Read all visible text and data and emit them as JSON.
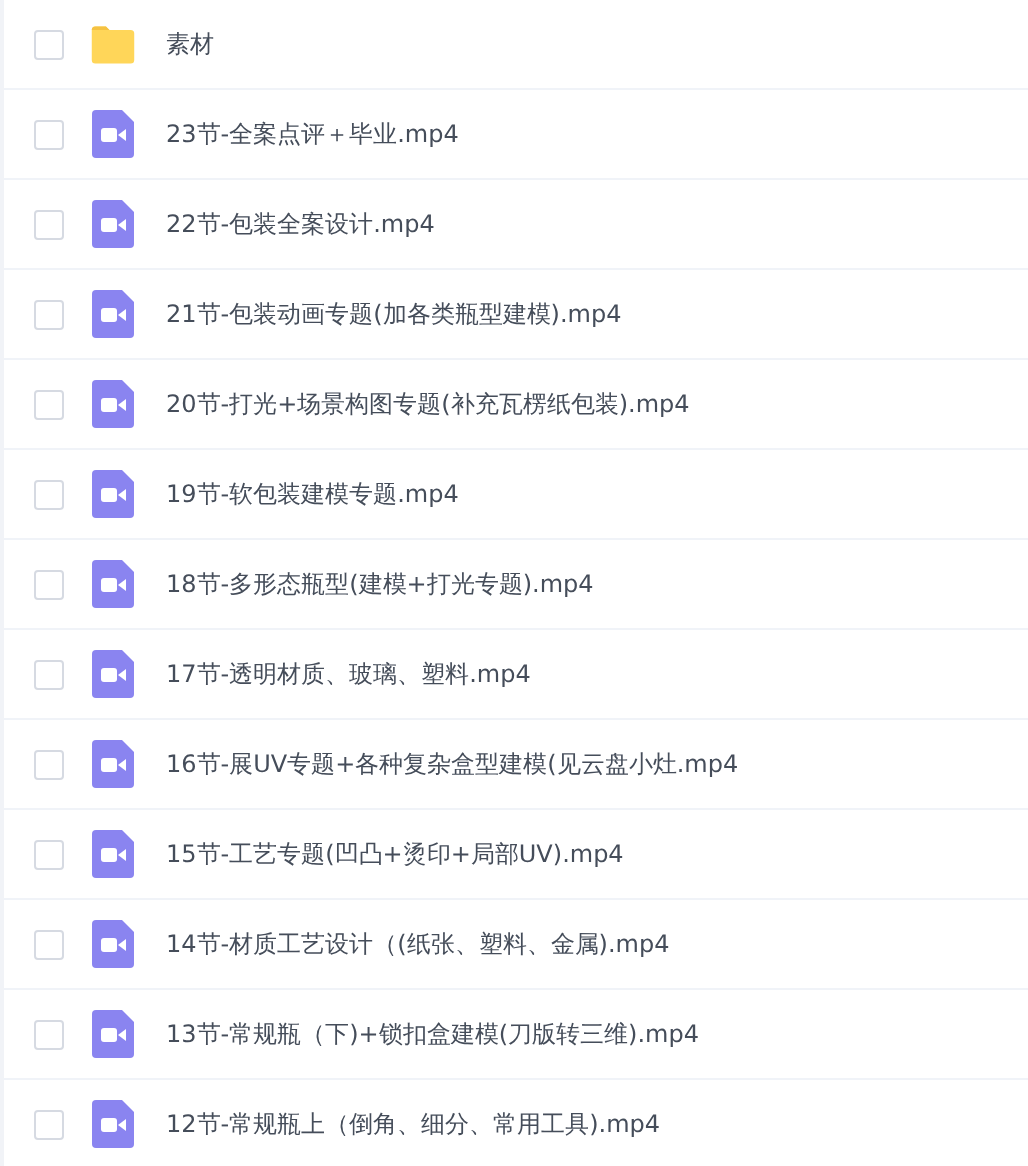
{
  "files": [
    {
      "kind": "folder",
      "name": "素材",
      "checked": false
    },
    {
      "kind": "video",
      "name": "23节-全案点评＋毕业.mp4",
      "checked": false
    },
    {
      "kind": "video",
      "name": "22节-包装全案设计.mp4",
      "checked": false
    },
    {
      "kind": "video",
      "name": "21节-包装动画专题(加各类瓶型建模).mp4",
      "checked": false
    },
    {
      "kind": "video",
      "name": "20节-打光+场景构图专题(补充瓦楞纸包装).mp4",
      "checked": false
    },
    {
      "kind": "video",
      "name": "19节-软包装建模专题.mp4",
      "checked": false
    },
    {
      "kind": "video",
      "name": "18节-多形态瓶型(建模+打光专题).mp4",
      "checked": false
    },
    {
      "kind": "video",
      "name": "17节-透明材质、玻璃、塑料.mp4",
      "checked": false
    },
    {
      "kind": "video",
      "name": "16节-展UV专题+各种复杂盒型建模(见云盘小灶.mp4",
      "checked": false
    },
    {
      "kind": "video",
      "name": "15节-工艺专题(凹凸+烫印+局部UV).mp4",
      "checked": false
    },
    {
      "kind": "video",
      "name": "14节-材质工艺设计（(纸张、塑料、金属).mp4",
      "checked": false
    },
    {
      "kind": "video",
      "name": "13节-常规瓶（下)+锁扣盒建模(刀版转三维).mp4",
      "checked": false
    },
    {
      "kind": "video",
      "name": "12节-常规瓶上（倒角、细分、常用工具).mp4",
      "checked": false
    }
  ]
}
